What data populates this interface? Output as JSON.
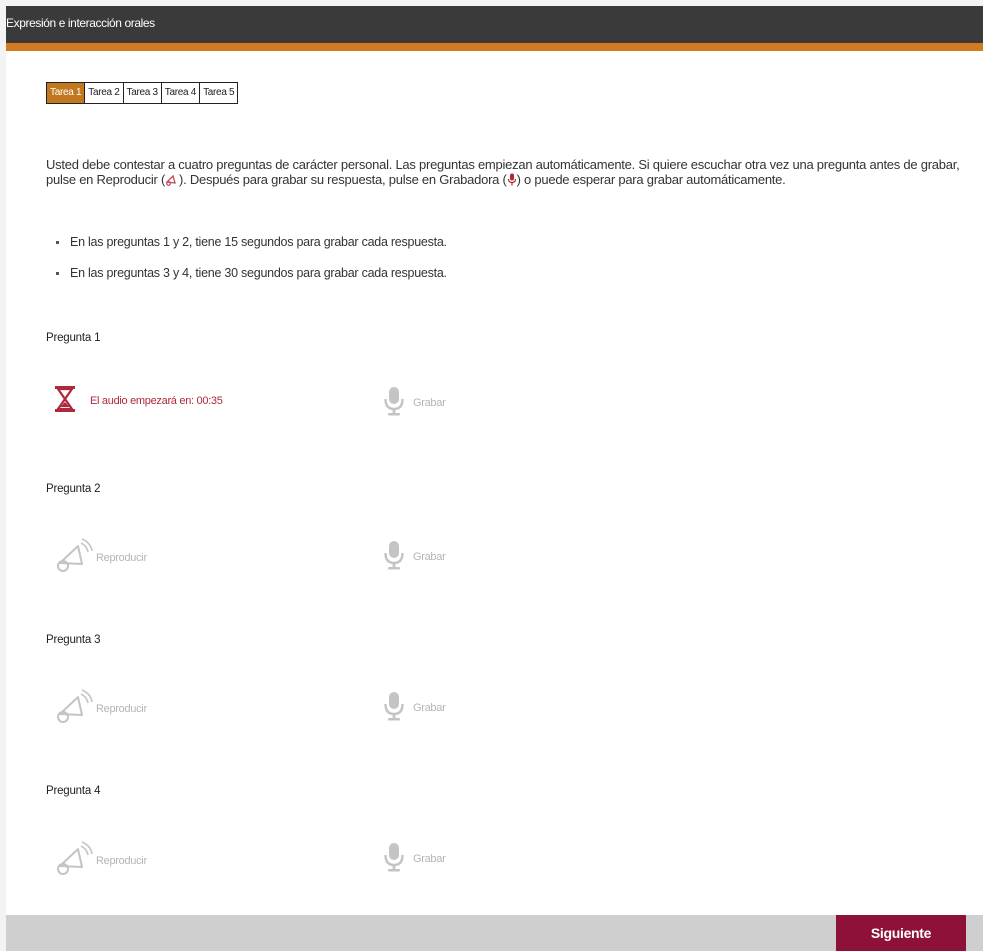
{
  "header": {
    "title": "Expresión e interacción orales"
  },
  "tabs": [
    {
      "label": "Tarea 1",
      "active": true
    },
    {
      "label": "Tarea 2",
      "active": false
    },
    {
      "label": "Tarea 3",
      "active": false
    },
    {
      "label": "Tarea 4",
      "active": false
    },
    {
      "label": "Tarea 5",
      "active": false
    }
  ],
  "instructions": {
    "part1": "Usted debe contestar a cuatro preguntas de carácter personal. Las preguntas empiezan automáticamente. Si quiere escuchar otra vez una pregunta antes de grabar, pulse en Reproducir (",
    "part2": "). Después para grabar su respuesta, pulse en Grabadora (",
    "part3": ") o puede esperar para grabar automáticamente.",
    "bullets": [
      "En las preguntas 1 y 2, tiene 15 segundos para grabar cada respuesta.",
      "En las preguntas 3 y 4, tiene 30 segundos para grabar cada respuesta."
    ]
  },
  "questions": [
    {
      "label": "Pregunta 1",
      "left_text": "El audio empezará en: 00:35",
      "left_icon": "hourglass-icon",
      "right_text": "Grabar",
      "right_icon": "microphone-icon"
    },
    {
      "label": "Pregunta 2",
      "left_text": "Reproducir",
      "left_icon": "speaker-icon",
      "right_text": "Grabar",
      "right_icon": "microphone-icon"
    },
    {
      "label": "Pregunta 3",
      "left_text": "Reproducir",
      "left_icon": "speaker-icon",
      "right_text": "Grabar",
      "right_icon": "microphone-icon"
    },
    {
      "label": "Pregunta 4",
      "left_text": "Reproducir",
      "left_icon": "speaker-icon",
      "right_text": "Grabar",
      "right_icon": "microphone-icon"
    }
  ],
  "footer": {
    "next_label": "Siguiente"
  },
  "colors": {
    "header_bg": "#3a3a3a",
    "accent": "#d47a23",
    "active_tab": "#c3781f",
    "timer": "#b0283b",
    "disabled": "#b5b5b5",
    "next_button": "#8e1238"
  }
}
